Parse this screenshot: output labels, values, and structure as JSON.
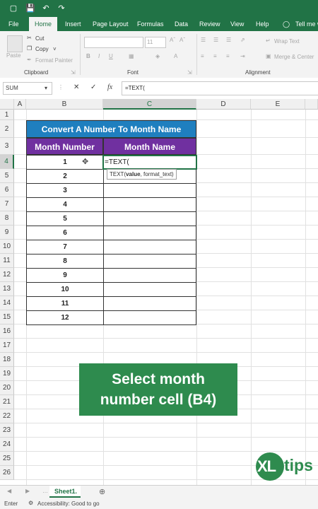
{
  "ribbon_tabs": [
    "File",
    "Home",
    "Insert",
    "Page Layout",
    "Formulas",
    "Data",
    "Review",
    "View",
    "Help",
    "Tell me w"
  ],
  "clipboard": {
    "paste": "Paste",
    "cut": "Cut",
    "copy": "Copy",
    "format_painter": "Format Painter",
    "group": "Clipboard"
  },
  "font": {
    "size": "11",
    "group": "Font"
  },
  "alignment": {
    "wrap": "Wrap Text",
    "merge": "Merge & Center",
    "group": "Alignment"
  },
  "formula_bar": {
    "name_box": "SUM",
    "fx": "fx",
    "formula": "=TEXT("
  },
  "columns": [
    "A",
    "B",
    "C",
    "D",
    "E"
  ],
  "rows": [
    "1",
    "2",
    "3",
    "4",
    "5",
    "6",
    "7",
    "8",
    "9",
    "10",
    "11",
    "12",
    "13",
    "14",
    "15",
    "16",
    "17",
    "18",
    "19",
    "20",
    "21",
    "22",
    "23",
    "24",
    "25",
    "26"
  ],
  "table": {
    "title": "Convert A Number To Month Name",
    "header_b": "Month Number",
    "header_c": "Month Name",
    "values": [
      "1",
      "2",
      "3",
      "4",
      "5",
      "6",
      "7",
      "8",
      "9",
      "10",
      "11",
      "12"
    ],
    "editing_cell": "=TEXT("
  },
  "tooltip": {
    "fn": "TEXT(",
    "arg1": "value",
    "rest": ", format_text)"
  },
  "callout": {
    "line1": "Select month",
    "line2": "number cell (B4)"
  },
  "logo": {
    "xl": "XL",
    "tips": "tips"
  },
  "sheet": {
    "name": "Sheet1."
  },
  "status": {
    "enter": "Enter",
    "accessibility": "Accessibility: Good to go"
  },
  "colors": {
    "excel_green": "#217346",
    "title_blue": "#1f7fbf",
    "header_purple": "#7030a0",
    "callout_green": "#2e8b4e"
  }
}
